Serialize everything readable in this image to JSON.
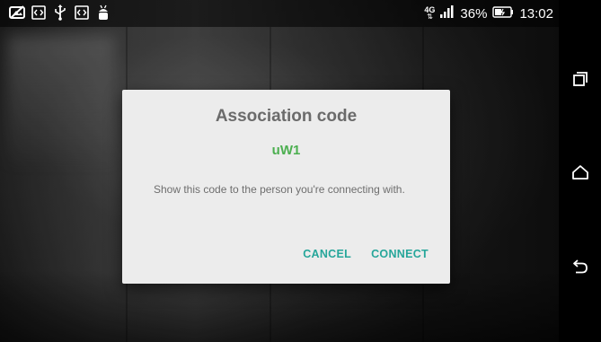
{
  "status_bar": {
    "left_icons": [
      "image-off-icon",
      "code-icon",
      "usb-icon",
      "code-icon",
      "android-icon"
    ],
    "network_type": "4G",
    "battery_percent": "36%",
    "time": "13:02"
  },
  "dialog": {
    "title": "Association code",
    "code": "uW1",
    "message": "Show this code to the person you're connecting with.",
    "cancel_label": "CANCEL",
    "connect_label": "CONNECT"
  },
  "nav_bar": {
    "icons": [
      "recents-icon",
      "home-icon",
      "back-icon"
    ]
  },
  "colors": {
    "accent_button": "#26a69a",
    "code_green": "#4caf50",
    "dialog_bg": "#ececec"
  }
}
